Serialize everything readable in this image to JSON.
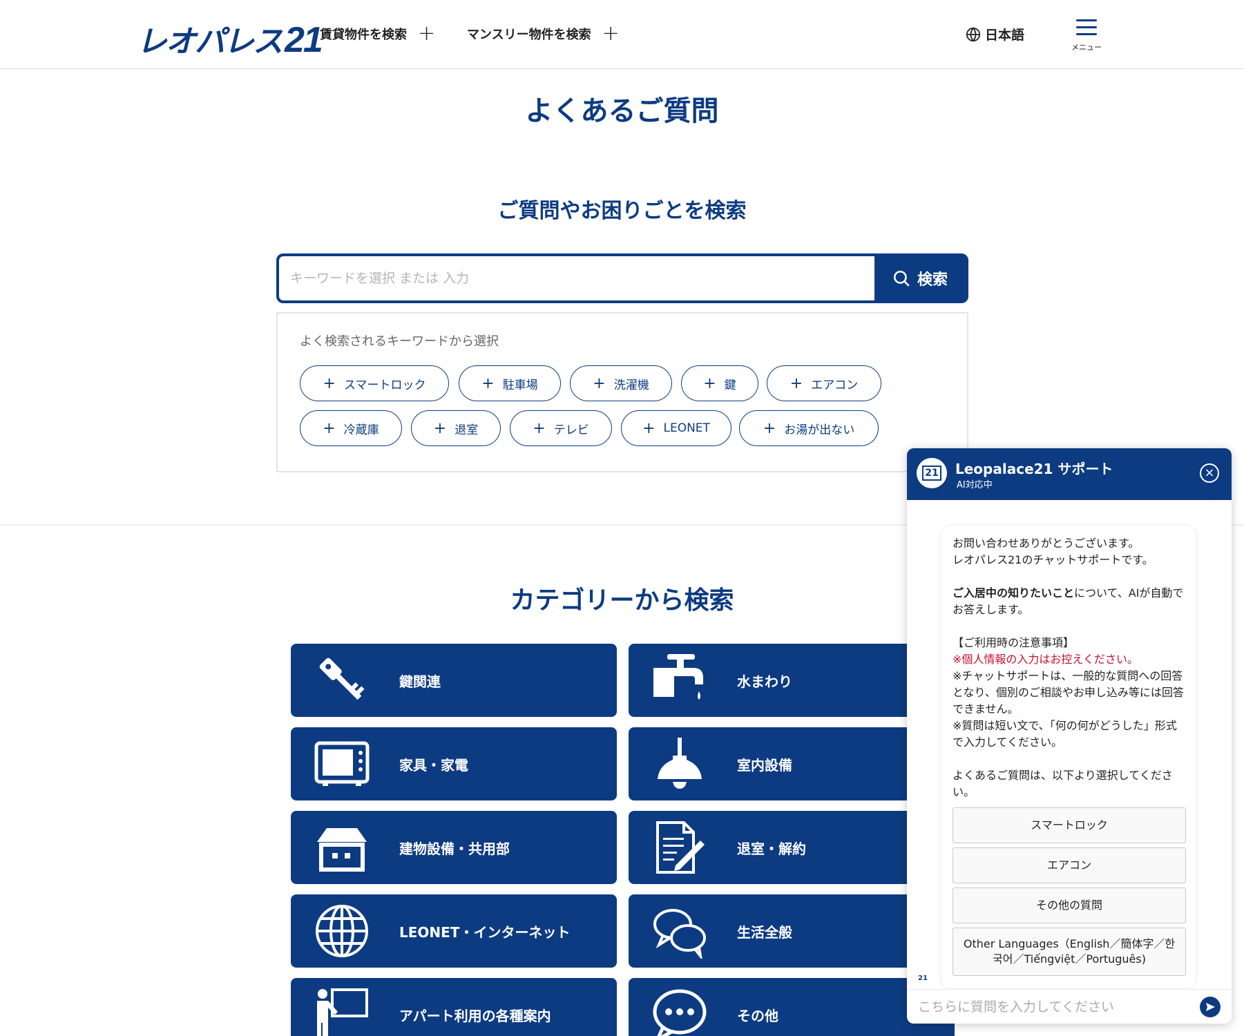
{
  "header": {
    "logo_text": "レオパレス",
    "logo_num": "21",
    "nav": [
      {
        "label": "賃貸物件を検索"
      },
      {
        "label": "マンスリー物件を検索"
      }
    ],
    "language": "日本語",
    "menu_label": "メニュー"
  },
  "page_title": "よくあるご質問",
  "search": {
    "title": "ご質問やお困りごとを検索",
    "placeholder": "キーワードを選択 または 入力",
    "button_label": "検索",
    "hint": "よく検索されるキーワードから選択",
    "keywords": [
      "スマートロック",
      "駐車場",
      "洗濯機",
      "鍵",
      "エアコン",
      "冷蔵庫",
      "退室",
      "テレビ",
      "LEONET",
      "お湯が出ない"
    ]
  },
  "categories": {
    "title": "カテゴリーから検索",
    "items": [
      {
        "label": "鍵関連",
        "icon": "key-icon"
      },
      {
        "label": "水まわり",
        "icon": "faucet-icon"
      },
      {
        "label": "家具・家電",
        "icon": "microwave-icon"
      },
      {
        "label": "室内設備",
        "icon": "ceiling-lamp-icon"
      },
      {
        "label": "建物設備・共用部",
        "icon": "building-icon"
      },
      {
        "label": "退室・解約",
        "icon": "document-pen-icon"
      },
      {
        "label": "LEONET・インターネット",
        "icon": "globe-icon"
      },
      {
        "label": "生活全般",
        "icon": "chat-bubbles-icon"
      },
      {
        "label": "アパート利用の各種案内",
        "icon": "presenter-board-icon"
      },
      {
        "label": "その他",
        "icon": "speech-bubble-dots-icon"
      }
    ]
  },
  "chat": {
    "title": "Leopalace21 サポート",
    "status": "AI対応中",
    "avatar_text": "21",
    "message": {
      "line1": "お問い合わせありがとうございます。",
      "line2": "レオパレス21のチャットサポートです。",
      "bold": "ご入居中の知りたいこと",
      "line3": "について、AIが自動でお答えします。",
      "notice_title": "【ご利用時の注意事項】",
      "notice_red": "※個人情報の入力はお控えください。",
      "notice2": "※チャットサポートは、一般的な質問への回答となり、個別のご相談やお申し込み等には回答できません。",
      "notice3": "※質問は短い文で、「何の何がどうした」形式で入力してください。",
      "faq_prompt": "よくあるご質問は、以下より選択してください。"
    },
    "quick_replies": [
      {
        "label": "スマートロック"
      },
      {
        "label": "エアコン"
      },
      {
        "label": "その他の質問"
      },
      {
        "label": "Other Languages（English／簡体字／한국어／Tiếngviệt／Português)"
      }
    ],
    "input_placeholder": "こちらに質問を入力してください"
  },
  "colors": {
    "brand": "#0d3b82",
    "warning": "#c8102e"
  }
}
